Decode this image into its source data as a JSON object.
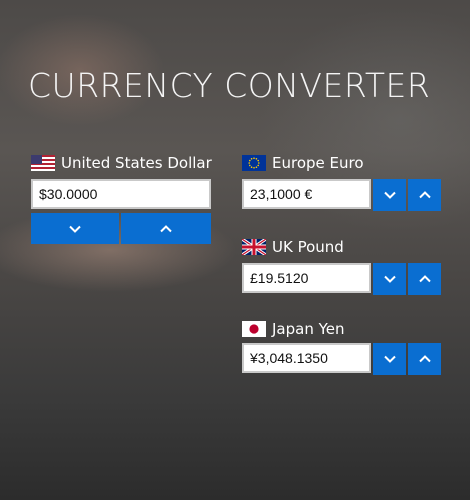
{
  "app": {
    "title": "CURRENCY CONVERTER"
  },
  "colors": {
    "accent": "#0a6ed1",
    "text": "#ffffff",
    "field_bg": "#ffffff"
  },
  "currencies": [
    {
      "name": "United States Dollar",
      "value": "$30.0000",
      "flag_icon": "us-flag-icon"
    },
    {
      "name": "Europe Euro",
      "value": "23,1000 €",
      "flag_icon": "eu-flag-icon"
    },
    {
      "name": "UK Pound",
      "value": "£19.5120",
      "flag_icon": "uk-flag-icon"
    },
    {
      "name": "Japan Yen",
      "value": "¥3,048.1350",
      "flag_icon": "jp-flag-icon"
    }
  ],
  "buttons": {
    "decrease_icon": "chevron-down-icon",
    "increase_icon": "chevron-up-icon"
  }
}
